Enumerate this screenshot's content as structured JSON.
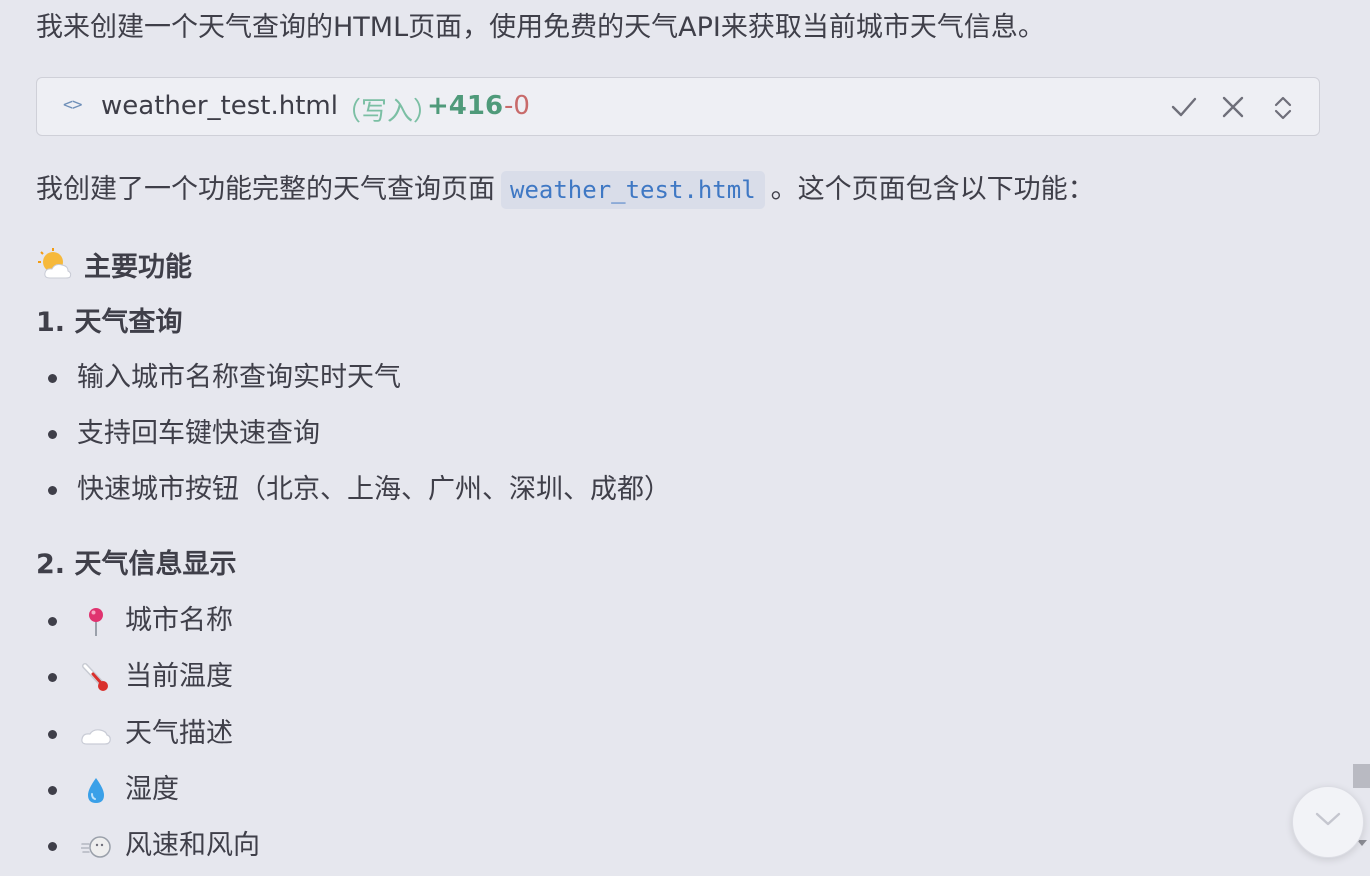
{
  "intro_text": "我来创建一个天气查询的HTML页面，使用免费的天气API来获取当前城市天气信息。",
  "file_change": {
    "icon": "code-icon",
    "filename": "weather_test.html",
    "mode": "（写入）",
    "added": "+416",
    "removed": "-0",
    "actions": [
      "accept-check-icon",
      "reject-x-icon",
      "expand-chevrons-icon"
    ]
  },
  "summary": {
    "before": "我创建了一个功能完整的天气查询页面",
    "code": "weather_test.html",
    "after": "。这个页面包含以下功能："
  },
  "features_heading": {
    "icon": "sun-behind-cloud-icon",
    "text": "主要功能"
  },
  "section1": {
    "title": "1. 天气查询",
    "items": [
      "输入城市名称查询实时天气",
      "支持回车键快速查询",
      "快速城市按钮（北京、上海、广州、深圳、成都）"
    ]
  },
  "section2": {
    "title": "2. 天气信息显示",
    "items": [
      {
        "icon": "round-pushpin-icon",
        "text": "城市名称"
      },
      {
        "icon": "thermometer-icon",
        "text": "当前温度"
      },
      {
        "icon": "cloud-icon",
        "text": "天气描述"
      },
      {
        "icon": "droplet-icon",
        "text": "湿度"
      },
      {
        "icon": "wind-face-icon",
        "text": "风速和风向"
      }
    ]
  },
  "colors": {
    "background": "#e6e7ee",
    "added": "#4f9a7a",
    "removed": "#c86a6a",
    "inline_code": "#3f78c4"
  }
}
